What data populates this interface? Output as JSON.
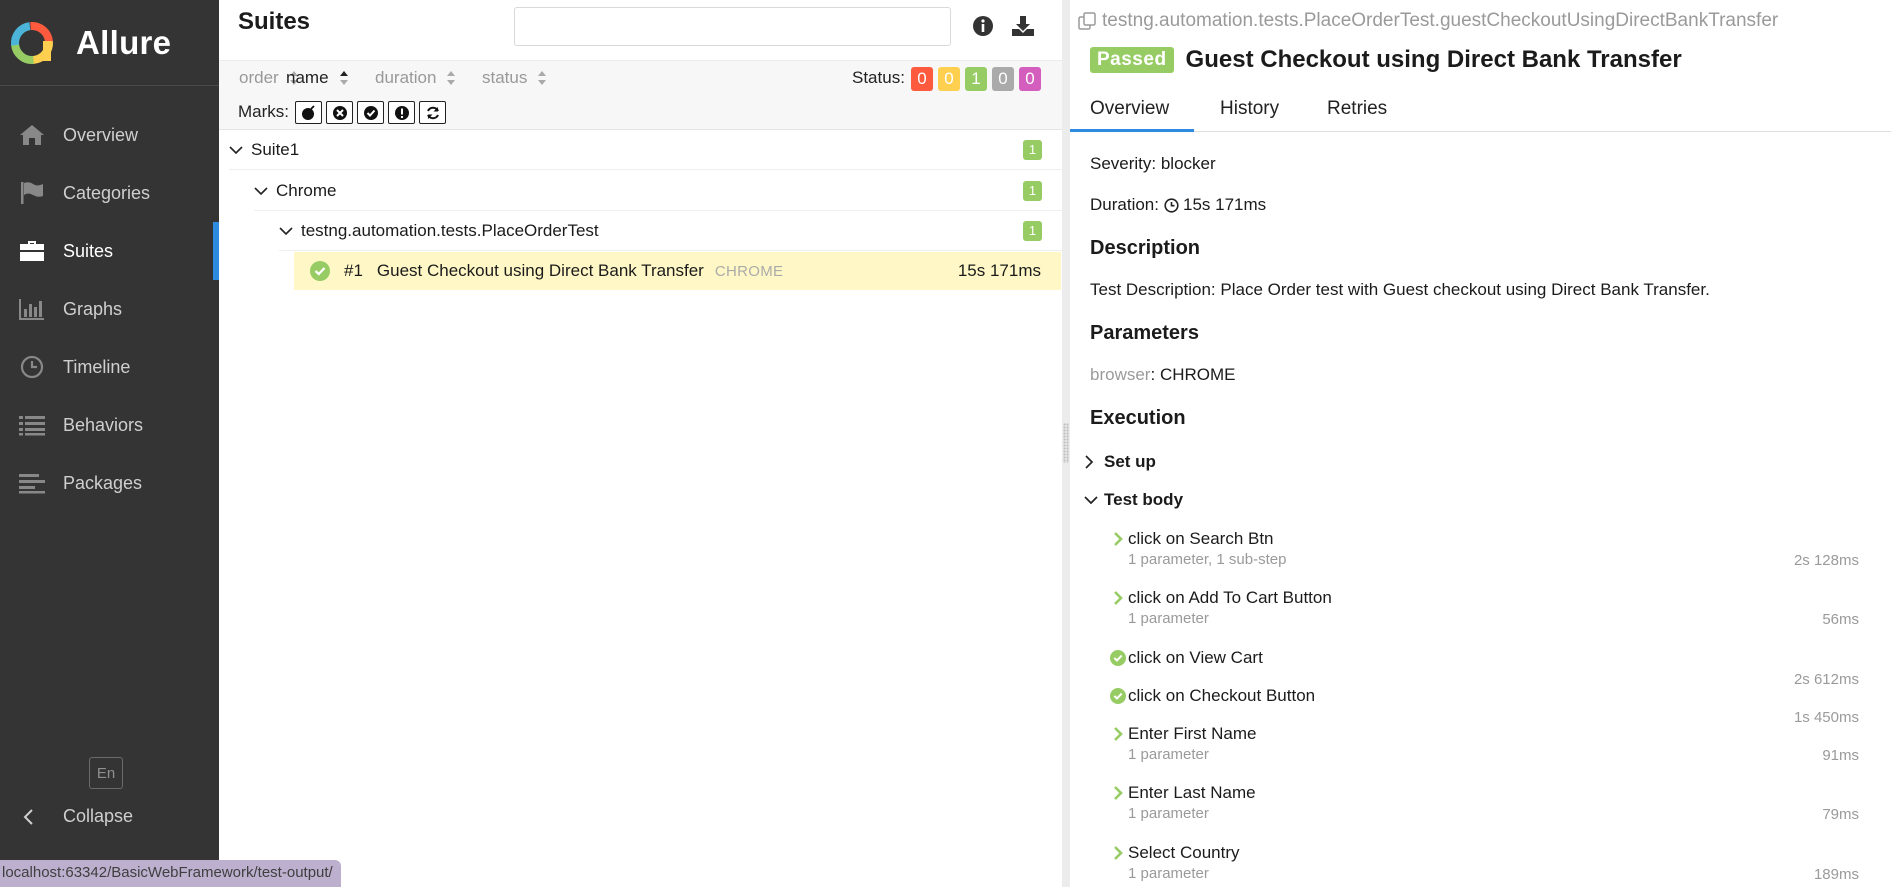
{
  "sidebar": {
    "brand": "Allure",
    "items": [
      {
        "label": "Overview",
        "icon": "home-icon"
      },
      {
        "label": "Categories",
        "icon": "flag-icon"
      },
      {
        "label": "Suites",
        "icon": "briefcase-icon",
        "active": true
      },
      {
        "label": "Graphs",
        "icon": "bar-chart-icon"
      },
      {
        "label": "Timeline",
        "icon": "clock-icon"
      },
      {
        "label": "Behaviors",
        "icon": "list-icon"
      },
      {
        "label": "Packages",
        "icon": "align-left-icon"
      }
    ],
    "language": "En",
    "collapse_label": "Collapse"
  },
  "status_url": "localhost:63342/BasicWebFramework/test-output/",
  "suites": {
    "title": "Suites",
    "search_placeholder": "",
    "sort": {
      "order": "order",
      "name": "name",
      "duration": "duration",
      "status": "status"
    },
    "status_label": "Status:",
    "status_counts": [
      {
        "value": "0",
        "color": "#fd5a3e"
      },
      {
        "value": "0",
        "color": "#ffd050"
      },
      {
        "value": "1",
        "color": "#97cc64"
      },
      {
        "value": "0",
        "color": "#aaaaaa"
      },
      {
        "value": "0",
        "color": "#d35ebe"
      }
    ],
    "marks_label": "Marks:",
    "tree": {
      "suite": {
        "label": "Suite1",
        "count": "1"
      },
      "browser": {
        "label": "Chrome",
        "count": "1"
      },
      "class": {
        "label": "testng.automation.tests.PlaceOrderTest",
        "count": "1"
      },
      "test": {
        "num": "#1",
        "name": "Guest Checkout using Direct Bank Transfer",
        "param": "CHROME",
        "duration": "15s 171ms"
      }
    }
  },
  "detail": {
    "path": "testng.automation.tests.PlaceOrderTest.guestCheckoutUsingDirectBankTransfer",
    "status": "Passed",
    "title": "Guest Checkout using Direct Bank Transfer",
    "tabs": [
      "Overview",
      "History",
      "Retries"
    ],
    "severity": "Severity: blocker",
    "duration_label": "Duration:",
    "duration": "15s 171ms",
    "description_heading": "Description",
    "description": "Test Description: Place Order test with Guest checkout using Direct Bank Transfer.",
    "parameters_heading": "Parameters",
    "param_key": "browser",
    "param_sep": ":",
    "param_value": "CHROME",
    "execution_heading": "Execution",
    "setup_label": "Set up",
    "body_label": "Test body",
    "steps": [
      {
        "name": "click on Search Btn",
        "sub": "1 parameter, 1 sub-step",
        "duration": "2s 128ms"
      },
      {
        "name": "click on Add To Cart Button",
        "sub": "1 parameter",
        "duration": "56ms"
      },
      {
        "name": "click on View Cart",
        "sub": "",
        "duration": "2s 612ms"
      },
      {
        "name": "click on Checkout Button",
        "sub": "",
        "duration": "1s 450ms"
      },
      {
        "name": "Enter First Name",
        "sub": "1 parameter",
        "duration": "91ms"
      },
      {
        "name": "Enter Last Name",
        "sub": "1 parameter",
        "duration": "79ms"
      },
      {
        "name": "Select Country",
        "sub": "1 parameter",
        "duration": "189ms"
      }
    ]
  },
  "colors": {
    "accent": "#2e8bdf",
    "passed": "#97cc64",
    "sidebar": "#343434",
    "selected_row": "#fff8c6"
  }
}
